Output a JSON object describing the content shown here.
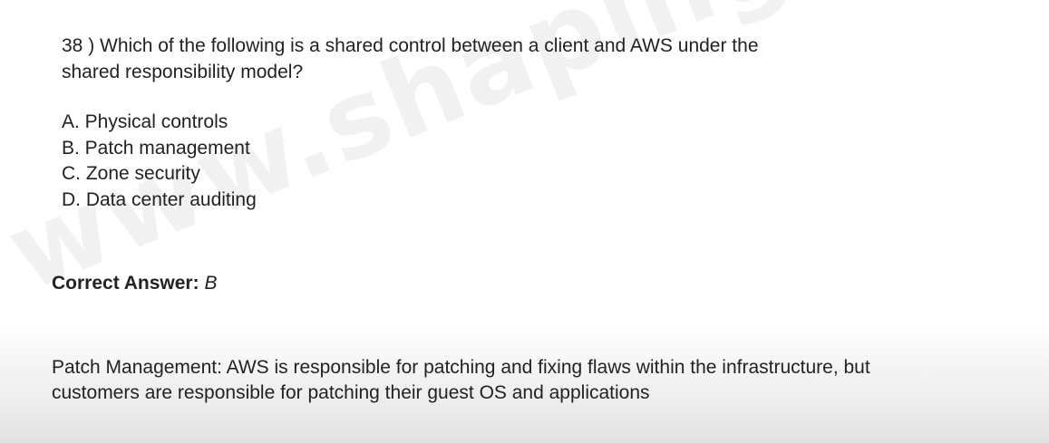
{
  "watermark": "www.shapingpixel.com",
  "question": {
    "number": "38 )",
    "text": "Which of the following is a shared control between a client and AWS under the shared responsibility model?"
  },
  "options": [
    "A. Physical controls",
    "B. Patch management",
    "C. Zone security",
    "D. Data center auditing"
  ],
  "answer": {
    "label": "Correct Answer:",
    "value": "B"
  },
  "explanation": "Patch Management: AWS is responsible for patching and fixing flaws within the infrastructure, but customers are responsible for patching their guest OS and applications"
}
